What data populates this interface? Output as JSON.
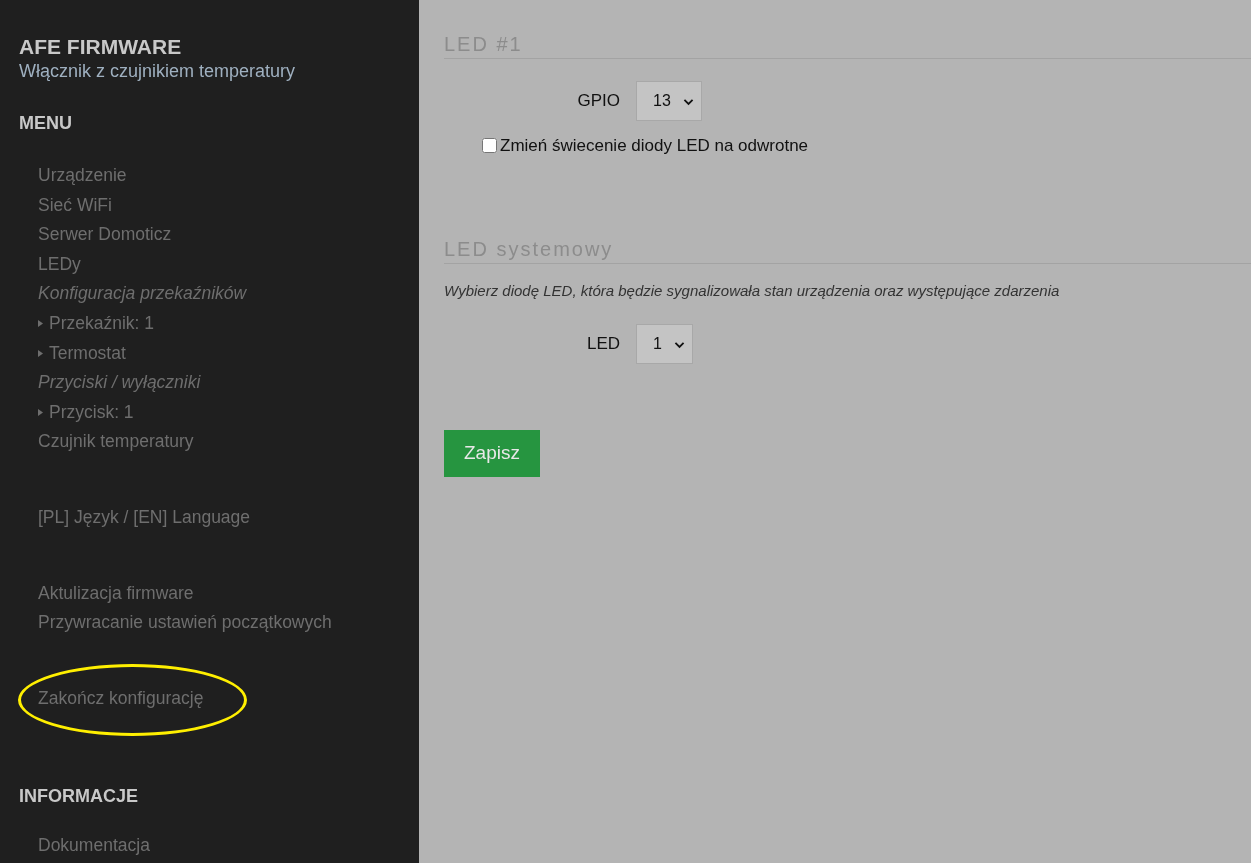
{
  "sidebar": {
    "title": "AFE FIRMWARE",
    "subtitle": "Włącznik z czujnikiem temperatury",
    "menu_heading": "MENU",
    "menu_groups": [
      [
        {
          "label": "Urządzenie",
          "kind": "link",
          "circled": false
        },
        {
          "label": "Sieć WiFi",
          "kind": "link",
          "circled": false
        },
        {
          "label": "Serwer Domoticz",
          "kind": "link",
          "circled": false
        },
        {
          "label": "LEDy",
          "kind": "link",
          "circled": false
        },
        {
          "label": "Konfiguracja przekaźników",
          "kind": "group",
          "circled": false
        },
        {
          "label": "Przekaźnik: 1",
          "kind": "sub",
          "circled": false
        },
        {
          "label": "Termostat",
          "kind": "sub",
          "circled": false
        },
        {
          "label": "Przyciski / wyłączniki",
          "kind": "group",
          "circled": false
        },
        {
          "label": "Przycisk: 1",
          "kind": "sub",
          "circled": false
        },
        {
          "label": "Czujnik temperatury",
          "kind": "link",
          "circled": false
        }
      ],
      [
        {
          "label": "[PL] Język / [EN] Language",
          "kind": "link",
          "circled": false
        }
      ],
      [
        {
          "label": "Aktulizacja firmware",
          "kind": "link",
          "circled": false
        },
        {
          "label": "Przywracanie ustawień początkowych",
          "kind": "link",
          "circled": false
        }
      ],
      [
        {
          "label": "Zakończ konfigurację",
          "kind": "link",
          "circled": true
        }
      ]
    ],
    "info_heading": "INFORMACJE",
    "info_items": [
      {
        "label": "Dokumentacja"
      }
    ]
  },
  "sections": [
    {
      "title": "LED #1",
      "fields": [
        {
          "kind": "select",
          "label": "GPIO",
          "value": "13"
        },
        {
          "kind": "checkbox",
          "label": "Zmień świecenie diody LED na odwrotne",
          "checked": false
        }
      ]
    },
    {
      "title": "LED systemowy",
      "description": "Wybierz diodę LED, która będzie sygnalizowała stan urządzenia oraz występujące zdarzenia",
      "fields": [
        {
          "kind": "select",
          "label": "LED",
          "value": "1"
        }
      ]
    }
  ],
  "save_button": "Zapisz"
}
